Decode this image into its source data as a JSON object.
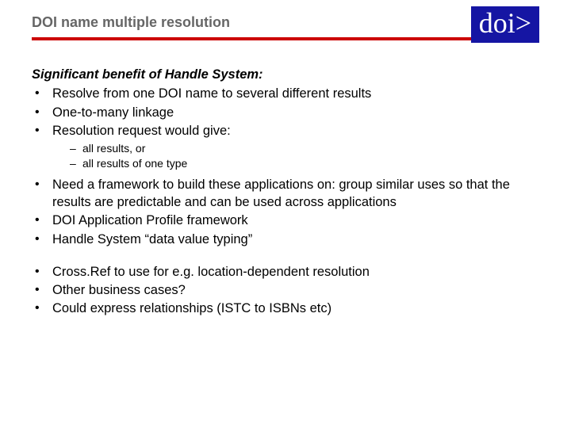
{
  "header": {
    "title": "DOI name multiple resolution",
    "logo": "doi>"
  },
  "intro": "Significant benefit of Handle System:",
  "group1": [
    "Resolve from one DOI name to several different results",
    "One-to-many linkage",
    "Resolution request would give:"
  ],
  "sub1": [
    "all results, or",
    "all results of one type"
  ],
  "group2": [
    "Need a framework to build these applications on: group similar uses so that the results are predictable and can be used across applications",
    "DOI Application Profile framework",
    "Handle System “data value typing”"
  ],
  "group3": [
    "Cross.Ref to use for e.g. location-dependent resolution",
    "Other business cases?",
    "Could express relationships (ISTC to ISBNs etc)"
  ]
}
